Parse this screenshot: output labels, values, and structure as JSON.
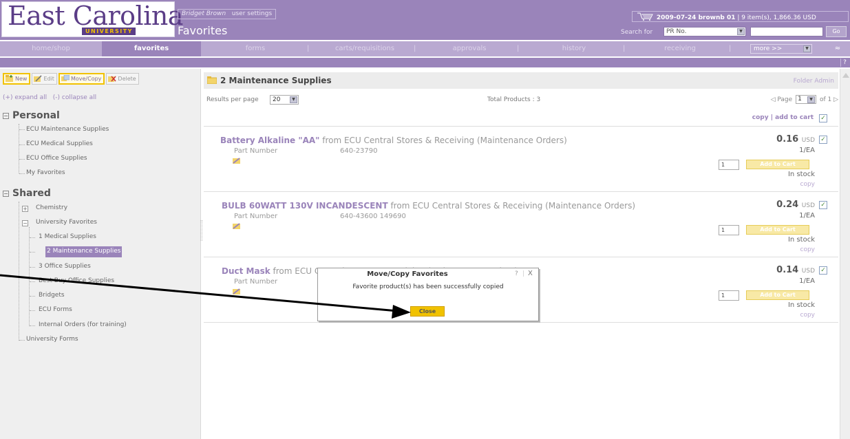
{
  "brand": {
    "name": "East Carolina",
    "sub": "UNIVERSITY"
  },
  "header": {
    "user_name": "Bridget Brown",
    "user_settings": "user settings",
    "page_title": "Favorites",
    "cart_summary_bold": "2009-07-24 brownb 01",
    "cart_summary_rest": " | 9 item(s), 1,866.36 USD",
    "search_label": "Search for",
    "search_type": "PR No.",
    "search_value": "",
    "go_label": "Go"
  },
  "nav": {
    "tabs": [
      "home/shop",
      "favorites",
      "forms",
      "carts/requisitions",
      "approvals",
      "history",
      "receiving"
    ],
    "more_label": "more >>"
  },
  "sidebar": {
    "toolbar": {
      "new": "New",
      "edit": "Edit",
      "move_copy": "Move/Copy",
      "delete": "Delete"
    },
    "expand_all": "(+) expand all",
    "collapse_all": "(-) collapse all",
    "personal_heading": "Personal",
    "personal_items": [
      "ECU Maintenance Supplies",
      "ECU Medical Supplies",
      "ECU Office Supplies",
      "My Favorites"
    ],
    "shared_heading": "Shared",
    "shared_items": {
      "chemistry": "Chemistry",
      "university_favorites": "University Favorites",
      "children": [
        "1 Medical Supplies",
        "2 Maintenance Supplies",
        "3 Office Supplies",
        "Best Buy Office Supplies",
        "Bridgets",
        "ECU Forms",
        "Internal Orders (for training)"
      ],
      "university_forms": "University Forms"
    }
  },
  "main": {
    "folder_title": "2 Maintenance Supplies",
    "folder_admin": "Folder Admin",
    "results_label": "Results per page",
    "results_per_page": "20",
    "total_products": "Total Products : 3",
    "page_label": "Page",
    "page_value": "1",
    "page_of": "of 1",
    "copy_link": "copy",
    "add_to_cart_link": "add to cart"
  },
  "products": [
    {
      "name": "Battery Alkaline \"AA\"",
      "supplier": " from ECU Central Stores & Receiving (Maintenance Orders)",
      "part_label": "Part Number",
      "part_number": "640-23790",
      "price": "0.16",
      "currency": "USD",
      "unit": "1/EA",
      "qty": "1",
      "add_label": "Add to Cart",
      "stock": "In stock",
      "copy": "copy"
    },
    {
      "name": "BULB 60WATT 130V INCANDESCENT",
      "supplier": " from ECU Central Stores & Receiving (Maintenance Orders)",
      "part_label": "Part Number",
      "part_number": "640-43600 149690",
      "price": "0.24",
      "currency": "USD",
      "unit": "1/EA",
      "qty": "1",
      "add_label": "Add to Cart",
      "stock": "In stock",
      "copy": "copy"
    },
    {
      "name": "Duct Mask",
      "supplier": " from ECU Central Stores & Receiving (Maintenance Orders)",
      "part_label": "Part Number",
      "part_number": "",
      "price": "0.14",
      "currency": "USD",
      "unit": "1/EA",
      "qty": "1",
      "add_label": "Add to Cart",
      "stock": "In stock",
      "copy": "copy"
    }
  ],
  "dialog": {
    "title": "Move/Copy Favorites",
    "help": "?",
    "close_x": "X",
    "message": "Favorite product(s) has been successfully copied",
    "close_label": "Close"
  },
  "colors": {
    "header_purple": "#9a84ba",
    "nav_purple": "#b9a9d1",
    "brand_purple": "#5b3d87",
    "accent_gold": "#f1c200"
  }
}
